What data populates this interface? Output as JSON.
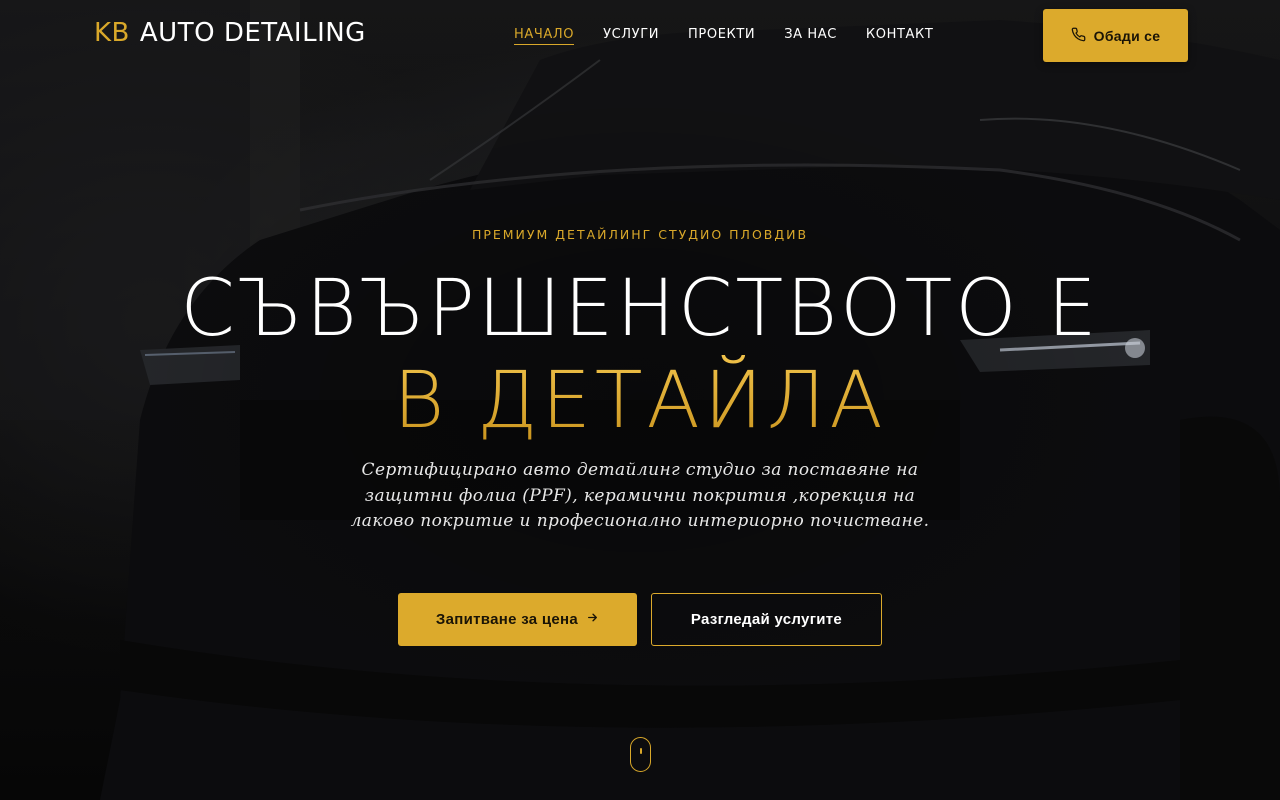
{
  "header": {
    "logo_kb": "KB",
    "logo_text": "AUTO DETAILING",
    "nav": [
      {
        "label": "НАЧАЛО",
        "active": true
      },
      {
        "label": "УСЛУГИ",
        "active": false
      },
      {
        "label": "ПРОЕКТИ",
        "active": false
      },
      {
        "label": "ЗА НАС",
        "active": false
      },
      {
        "label": "КОНТАКТ",
        "active": false
      }
    ],
    "call_button": {
      "label": "Обади се",
      "icon": "phone-icon"
    }
  },
  "hero": {
    "eyebrow": "ПРЕМИУМ ДЕТАЙЛИНГ СТУДИО ПЛОВДИВ",
    "headline_line1": "СЪВЪРШЕНСТВОТО Е",
    "headline_line2": "В ДЕТАЙЛА",
    "subtitle": "Сертифицирано авто детайлинг студио за поставяне на защитни фолиа (PPF), керамични покрития ,корекция на лаково покритие и професионално интериорно почистване.",
    "primary_button": {
      "label": "Запитване за цена",
      "icon": "arrow-right-icon"
    },
    "secondary_button": {
      "label": "Разгледай услугите"
    },
    "scroll_indicator": "mouse-scroll-icon"
  },
  "colors": {
    "accent": "#dcaa2c",
    "background": "#0b0b0c",
    "text": "#ffffff"
  }
}
